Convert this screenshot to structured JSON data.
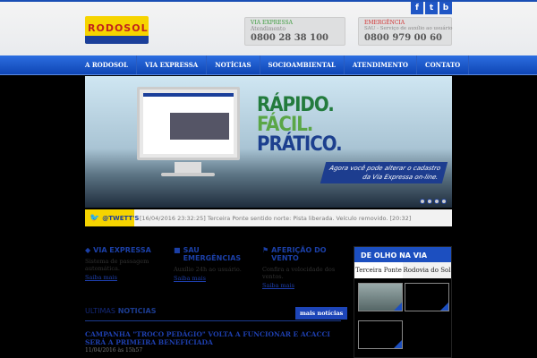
{
  "header": {
    "logo": "RODOSOL",
    "social": [
      "f",
      "t",
      "b"
    ],
    "via_expressa": {
      "title": "VIA EXPRESSA",
      "sub": "Atendimento",
      "phone": "0800 28 38 100"
    },
    "emergencia": {
      "title": "EMERGÊNCIA",
      "sub": "SAU - Serviço de auxílio ao usuário",
      "phone": "0800 979 00 60"
    }
  },
  "nav": [
    "A RODOSOL",
    "VIA EXPRESSA",
    "NOTÍCIAS",
    "SOCIOAMBIENTAL",
    "ATENDIMENTO",
    "CONTATO"
  ],
  "banner": {
    "line1": "RÁPIDO.",
    "line2": "FÁCIL.",
    "line3": "PRÁTICO.",
    "caption1": "Agora você pode alterar o cadastro",
    "caption2": "da Via Expressa on-line."
  },
  "ticker": {
    "label": "@TWETT'S",
    "message": "[16/04/2016 23:32:25] Terceira Ponte sentido norte: Pista liberada. Veículo removido. [20:32]"
  },
  "features": [
    {
      "title": "VIA EXPRESSA",
      "text": "Sistema de passagem automática.",
      "link": "Saiba mais"
    },
    {
      "title": "SAU EMERGÊNCIAS",
      "text": "Auxílio 24h ao usuário.",
      "link": "Saiba mais"
    },
    {
      "title": "AFERIÇÃO DO VENTO",
      "text": "Confira a velocidade dos ventos.",
      "link": "Saiba mais"
    }
  ],
  "olho": {
    "title": "DE OLHO NA VIA",
    "tabs": [
      "Terceira Ponte",
      "Rodovia do Sol"
    ]
  },
  "news": {
    "title_light": "ULTIMAS",
    "title_bold": "NOTICIAS",
    "more": "mais notícias",
    "items": [
      {
        "title": "CAMPANHA \"TROCO PEDÁGIO\" VOLTA A FUNCIONAR E ACACCI SERÁ A PRIMEIRA BENEFICIADA",
        "date": "11/04/2016 às 15h57"
      }
    ]
  }
}
